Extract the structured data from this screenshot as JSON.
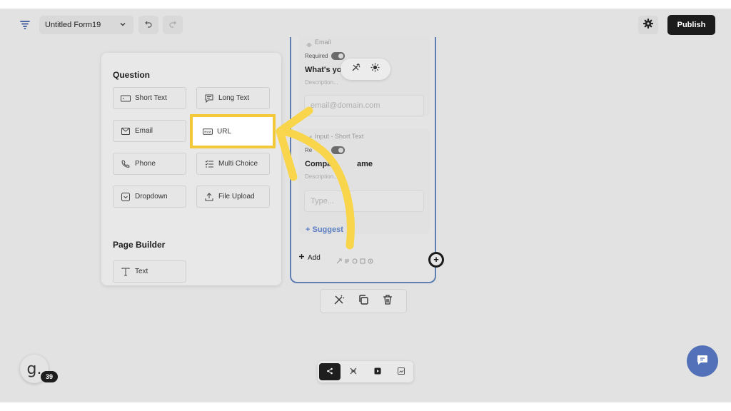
{
  "header": {
    "form_name": "Untitled Form19",
    "publish_label": "Publish"
  },
  "panel": {
    "question_title": "Question",
    "page_builder_title": "Page Builder",
    "question_items": [
      {
        "label": "Short Text",
        "icon": "short-text-icon"
      },
      {
        "label": "Long Text",
        "icon": "long-text-icon"
      },
      {
        "label": "Email",
        "icon": "email-icon"
      },
      {
        "label": "URL",
        "icon": "url-icon"
      },
      {
        "label": "Phone",
        "icon": "phone-icon"
      },
      {
        "label": "Multi Choice",
        "icon": "multi-choice-icon"
      },
      {
        "label": "Dropdown",
        "icon": "dropdown-icon"
      },
      {
        "label": "File Upload",
        "icon": "file-upload-icon"
      }
    ],
    "page_builder_items": [
      {
        "label": "Text",
        "icon": "text-icon"
      }
    ]
  },
  "canvas": {
    "email_block": {
      "type_label": "Email",
      "required_label": "Required",
      "question": "What's you",
      "description": "Description...",
      "placeholder": "email@domain.com"
    },
    "company_block": {
      "type_label": "Input - Short Text",
      "required_label": "Re",
      "question": "Compa",
      "question_tail": "ame",
      "description": "Description...",
      "placeholder": "Type..."
    },
    "suggest_label": "+ Suggest",
    "add_label": "Add"
  },
  "avatar": {
    "letter": "g.",
    "badge": "39"
  },
  "colors": {
    "highlight": "#f3c93a",
    "arrow": "#f8d54b",
    "canvas_border": "#5f7fb3",
    "chat_button": "#5371b8"
  }
}
